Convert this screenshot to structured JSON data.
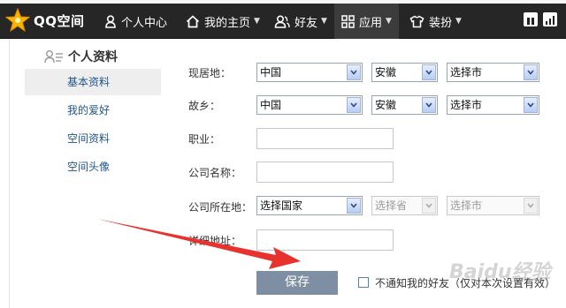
{
  "topbar": {
    "brand": "QQ空间",
    "nav": [
      {
        "label": "个人中心",
        "icon": "person-icon"
      },
      {
        "label": "我的主页",
        "icon": "home-icon"
      },
      {
        "label": "好友",
        "icon": "friends-icon"
      },
      {
        "label": "应用",
        "icon": "apps-icon"
      },
      {
        "label": "装扮",
        "icon": "shirt-icon"
      }
    ]
  },
  "sidebar": {
    "title": "个人资料",
    "items": [
      "基本资料",
      "我的爱好",
      "空间资料",
      "空间头像"
    ],
    "active_index": 0
  },
  "form": {
    "residence": {
      "label": "现居地：",
      "country": "中国",
      "province": "安徽",
      "city": "选择市"
    },
    "hometown": {
      "label": "故乡：",
      "country": "中国",
      "province": "安徽",
      "city": "选择市"
    },
    "occupation": {
      "label": "职业：",
      "value": ""
    },
    "company_name": {
      "label": "公司名称：",
      "value": ""
    },
    "company_location": {
      "label": "公司所在地：",
      "country": "选择国家",
      "province": "选择省",
      "city": "选择市"
    },
    "address": {
      "label": "详细地址：",
      "value": ""
    },
    "save_label": "保存",
    "notify_label": "不通知我的好友（仅对本次设置有效）"
  },
  "watermark": "Baidu经验",
  "colors": {
    "topbar": "#262626",
    "link": "#225588",
    "save_button": "#7f8fa3",
    "annotation_arrow": "#e8322e"
  }
}
